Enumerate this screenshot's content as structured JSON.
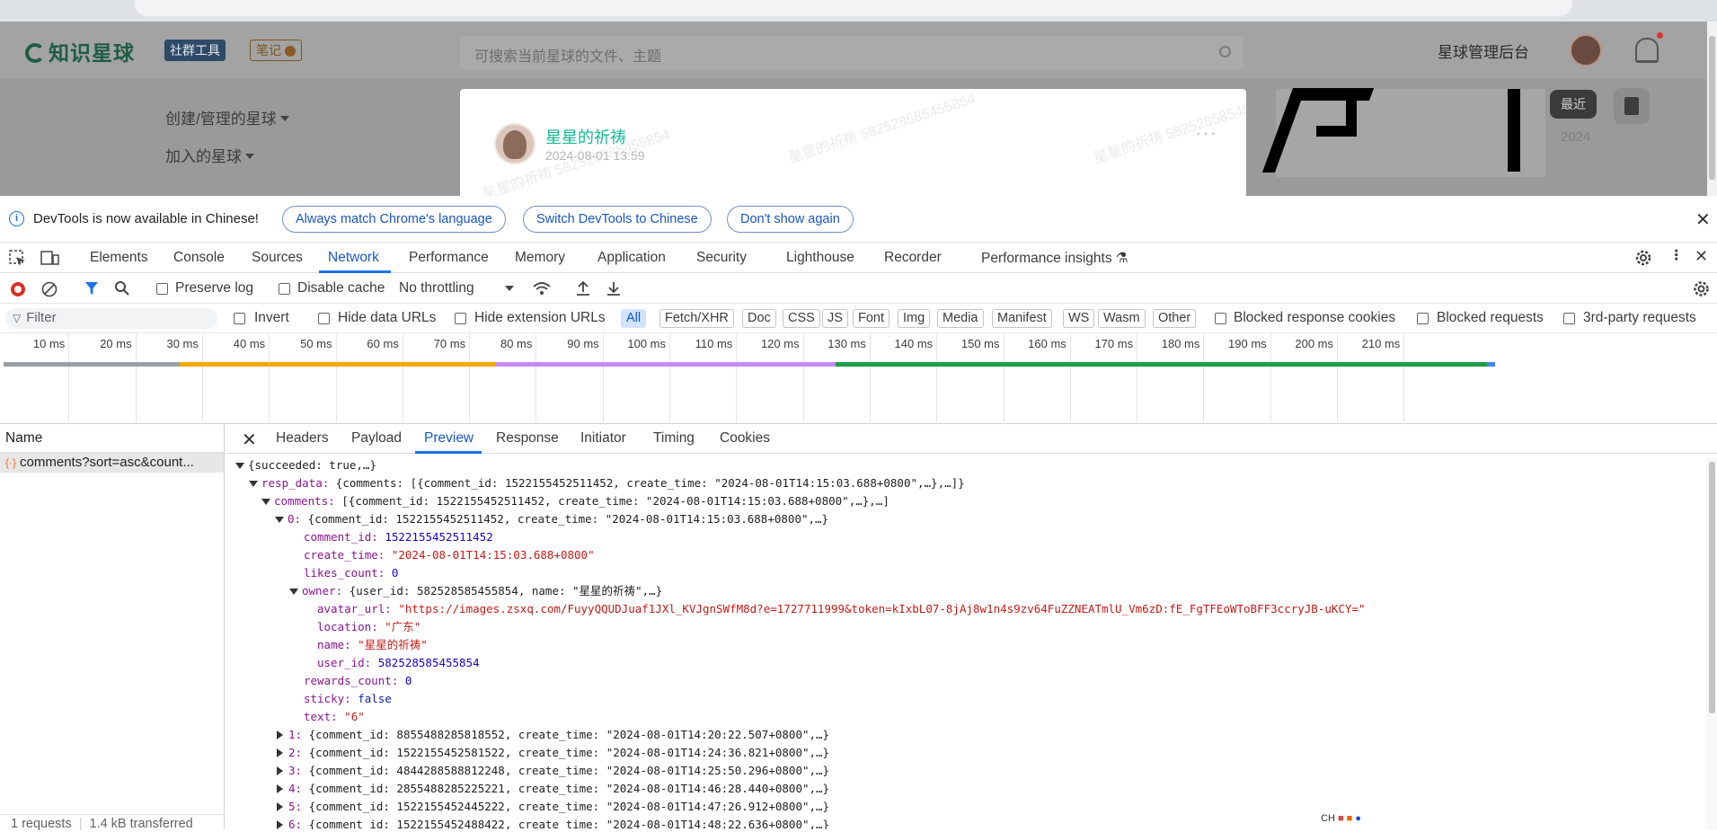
{
  "website": {
    "logo": "知识星球",
    "tag_tools": "社群工具",
    "tag_notes": "笔记",
    "search_placeholder": "可搜索当前星球的文件、主题",
    "admin_link": "星球管理后台",
    "side_links": [
      "创建/管理的星球",
      "加入的星球"
    ],
    "post": {
      "author": "星星的祈祷",
      "date": "2024-08-01 13:59",
      "more": "···"
    },
    "watermark": "星星的祈祷 582528585455854",
    "recent_label": "最近",
    "year_label": "2024"
  },
  "infobar": {
    "message": "DevTools is now available in Chinese!",
    "buttons": [
      "Always match Chrome's language",
      "Switch DevTools to Chinese",
      "Don't show again"
    ]
  },
  "devtools_tabs": [
    "Elements",
    "Console",
    "Sources",
    "Network",
    "Performance",
    "Memory",
    "Application",
    "Security",
    "Lighthouse",
    "Recorder",
    "Performance insights"
  ],
  "active_tab": "Network",
  "network_toolbar": {
    "preserve_log": "Preserve log",
    "disable_cache": "Disable cache",
    "throttling": "No throttling"
  },
  "filter_bar": {
    "placeholder": "Filter",
    "invert": "Invert",
    "hide_data_urls": "Hide data URLs",
    "hide_extension_urls": "Hide extension URLs",
    "types": [
      "All",
      "Fetch/XHR",
      "Doc",
      "CSS",
      "JS",
      "Font",
      "Img",
      "Media",
      "Manifest",
      "WS",
      "Wasm",
      "Other"
    ],
    "selected_type": "All",
    "blocked_cookies": "Blocked response cookies",
    "blocked_requests": "Blocked requests",
    "third_party": "3rd-party requests"
  },
  "timeline": {
    "ticks": [
      "10 ms",
      "20 ms",
      "30 ms",
      "40 ms",
      "50 ms",
      "60 ms",
      "70 ms",
      "80 ms",
      "90 ms",
      "100 ms",
      "110 ms",
      "120 ms",
      "130 ms",
      "140 ms",
      "150 ms",
      "160 ms",
      "170 ms",
      "180 ms",
      "190 ms",
      "200 ms",
      "210 ms"
    ],
    "colors": {
      "queue": "#9aa0a6",
      "connect": "#f2a900",
      "request": "#c58af9",
      "download": "#1e9e48",
      "end": "#4285f4"
    }
  },
  "requests": {
    "header": "Name",
    "rows": [
      "comments?sort=asc&count..."
    ],
    "summary": "1 requests",
    "transferred": "1.4 kB transferred"
  },
  "detail_tabs": [
    "Headers",
    "Payload",
    "Preview",
    "Response",
    "Initiator",
    "Timing",
    "Cookies"
  ],
  "active_detail_tab": "Preview",
  "preview": {
    "root": "{succeeded: true,…}",
    "resp_data_key": "resp_data:",
    "resp_data_val": "{comments: [{comment_id: 1522155452511452, create_time: \"2024-08-01T14:15:03.688+0800\",…},…]}",
    "comments_key": "comments:",
    "comments_val": "[{comment_id: 1522155452511452, create_time: \"2024-08-01T14:15:03.688+0800\",…},…]",
    "item0_key": "0:",
    "item0_val": "{comment_id: 1522155452511452, create_time: \"2024-08-01T14:15:03.688+0800\",…}",
    "fields": [
      {
        "key": "comment_id:",
        "val": "1522155452511452",
        "type": "n"
      },
      {
        "key": "create_time:",
        "val": "\"2024-08-01T14:15:03.688+0800\"",
        "type": "s"
      },
      {
        "key": "likes_count:",
        "val": "0",
        "type": "n"
      }
    ],
    "owner_key": "owner:",
    "owner_val": "{user_id: 582528585455854, name: \"星星的祈祷\",…}",
    "owner_fields": [
      {
        "key": "avatar_url:",
        "val": "\"https://images.zsxq.com/FuyyQQUDJuaf1JXl_KVJgnSWfM8d?e=1727711999&token=kIxbL07-8jAj8w1n4s9zv64FuZZNEATmlU_Vm6zD:fE_FgTFEoWToBFF3ccryJB-uKCY=\"",
        "type": "s"
      },
      {
        "key": "location:",
        "val": "\"广东\"",
        "type": "s"
      },
      {
        "key": "name:",
        "val": "\"星星的祈祷\"",
        "type": "s"
      },
      {
        "key": "user_id:",
        "val": "582528585455854",
        "type": "n"
      }
    ],
    "after_fields": [
      {
        "key": "rewards_count:",
        "val": "0",
        "type": "n"
      },
      {
        "key": "sticky:",
        "val": "false",
        "type": "b"
      },
      {
        "key": "text:",
        "val": "\"6\"",
        "type": "s"
      }
    ],
    "collapsed": [
      {
        "key": "1:",
        "val": "{comment_id: 8855488285818552, create_time: \"2024-08-01T14:20:22.507+0800\",…}"
      },
      {
        "key": "2:",
        "val": "{comment_id: 1522155452581522, create_time: \"2024-08-01T14:24:36.821+0800\",…}"
      },
      {
        "key": "3:",
        "val": "{comment_id: 4844288588812248, create_time: \"2024-08-01T14:25:50.296+0800\",…}"
      },
      {
        "key": "4:",
        "val": "{comment_id: 2855488285225221, create_time: \"2024-08-01T14:46:28.440+0800\",…}"
      },
      {
        "key": "5:",
        "val": "{comment_id: 1522155452445222, create_time: \"2024-08-01T14:47:26.912+0800\",…}"
      },
      {
        "key": "6:",
        "val": "{comment_id: 1522155452488422, create_time: \"2024-08-01T14:48:22.636+0800\",…}"
      }
    ]
  },
  "tray_text": "CH"
}
